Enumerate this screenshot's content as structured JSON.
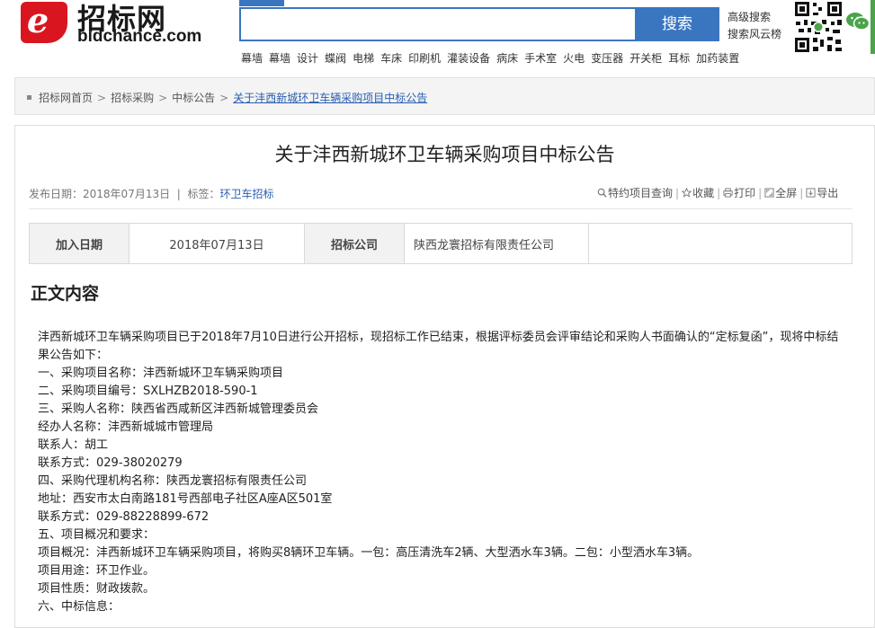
{
  "header": {
    "logo_cn": "招标网",
    "logo_en": "bidchance.com",
    "search_placeholder": "",
    "search_button": "搜索",
    "advanced_search": "高级搜索",
    "search_rank": "搜索风云榜",
    "hot_words": [
      "幕墙",
      "幕墙",
      "设计",
      "蝶阀",
      "电梯",
      "车床",
      "印刷机",
      "灌装设备",
      "病床",
      "手术室",
      "火电",
      "变压器",
      "开关柜",
      "耳标",
      "加药装置"
    ]
  },
  "breadcrumb": {
    "items": [
      "招标网首页",
      "招标采购",
      "中标公告"
    ],
    "current": "关于沣西新城环卫车辆采购项目中标公告"
  },
  "article": {
    "title": "关于沣西新城环卫车辆采购项目中标公告",
    "publish_label": "发布日期：",
    "publish_date": "2018年07月13日",
    "tag_label": "标签：",
    "tag_value": "环卫车招标",
    "tools": [
      "特约项目查询",
      "收藏",
      "打印",
      "全屏",
      "导出"
    ],
    "info_table": {
      "join_date_label": "加入日期",
      "join_date": "2018年07月13日",
      "company_label": "招标公司",
      "company": "陕西龙寰招标有限责任公司"
    },
    "section_title": "正文内容",
    "body_lines": [
      "沣西新城环卫车辆采购项目已于2018年7月10日进行公开招标，现招标工作已结束，根据评标委员会评审结论和采购人书面确认的“定标复函”，现将中标结果公告如下：",
      "一、采购项目名称：沣西新城环卫车辆采购项目",
      "二、采购项目编号：SXLHZB2018-590-1",
      "三、采购人名称：陕西省西咸新区沣西新城管理委员会",
      "经办人名称：沣西新城城市管理局",
      "联系人：胡工",
      "联系方式：029-38020279",
      "四、采购代理机构名称：陕西龙寰招标有限责任公司",
      "地址：西安市太白南路181号西部电子社区A座A区501室",
      "联系方式：029-88228899-672",
      "五、项目概况和要求：",
      "项目概况：沣西新城环卫车辆采购项目，将购买8辆环卫车辆。一包：高压清洗车2辆、大型洒水车3辆。二包：小型洒水车3辆。",
      "项目用途：环卫作业。",
      "项目性质：财政拨款。",
      "六、中标信息："
    ]
  },
  "colors": {
    "brand_red": "#d9161f",
    "accent_blue": "#3a76c0",
    "link_blue": "#2a5db0"
  }
}
